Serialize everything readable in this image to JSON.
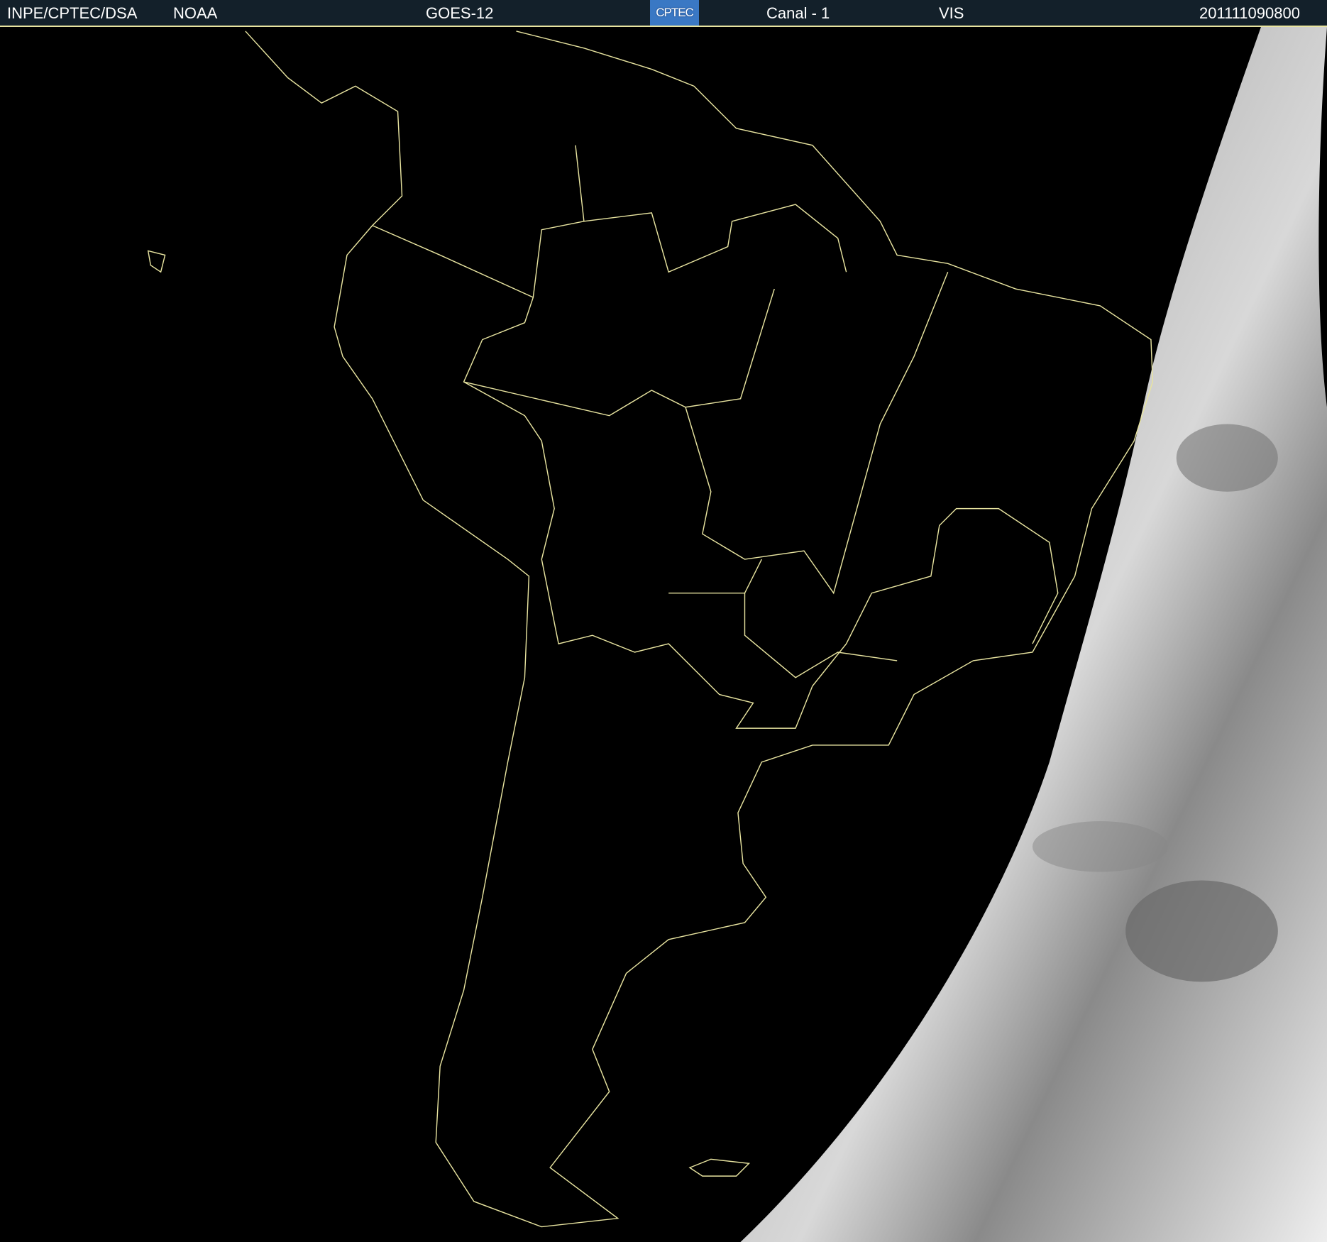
{
  "header": {
    "institution": "INPE/CPTEC/DSA",
    "agency": "NOAA",
    "satellite": "GOES-12",
    "logo_text": "CPTEC",
    "channel": "Canal - 1",
    "band": "VIS",
    "timestamp": "201111090800"
  },
  "colors": {
    "header_bg": "#13202a",
    "border": "#e8e4a0",
    "cloud": "#c8c8c8"
  }
}
